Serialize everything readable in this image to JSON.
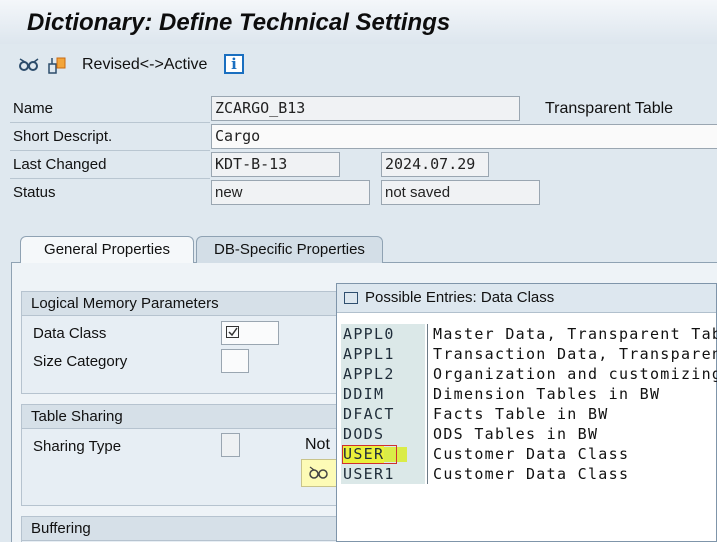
{
  "title": "Dictionary: Define Technical Settings",
  "toolbar": {
    "icons": [
      "glasses-icon",
      "activate-icon",
      "info-icon"
    ],
    "revised_active_label": "Revised<->Active",
    "info_label": "i"
  },
  "header": {
    "name_label": "Name",
    "name_value": "ZCARGO_B13",
    "table_type": "Transparent Table",
    "short_desc_label": "Short Descript.",
    "short_desc_value": "Cargo",
    "last_changed_label": "Last Changed",
    "last_changed_user": "KDT-B-13",
    "last_changed_date": "2024.07.29",
    "status_label": "Status",
    "status_value": "new",
    "status_saved": "not saved"
  },
  "tabs": {
    "general": "General Properties",
    "db_specific": "DB-Specific Properties"
  },
  "logical_memory": {
    "title": "Logical Memory Parameters",
    "data_class_label": "Data Class",
    "size_category_label": "Size Category"
  },
  "table_sharing": {
    "title": "Table Sharing",
    "sharing_type_label": "Sharing Type",
    "not_text": "Not"
  },
  "buffering": {
    "title": "Buffering"
  },
  "popup": {
    "title": "Possible Entries: Data Class",
    "entries": [
      {
        "code": "APPL0",
        "desc": "Master Data, Transparent Tabl"
      },
      {
        "code": "APPL1",
        "desc": "Transaction Data, Transparent"
      },
      {
        "code": "APPL2",
        "desc": "Organization and customizing"
      },
      {
        "code": "DDIM",
        "desc": "Dimension Tables in BW"
      },
      {
        "code": "DFACT",
        "desc": "Facts Table in BW"
      },
      {
        "code": "DODS",
        "desc": "ODS Tables in BW"
      },
      {
        "code": "USER",
        "desc": "Customer Data Class"
      },
      {
        "code": "USER1",
        "desc": "Customer Data Class"
      }
    ]
  },
  "colors": {
    "highlight": "#d9ec2a",
    "selection_border": "#d03030",
    "code_column_bg": "#dbe8e8",
    "info_icon": "#1a6fc0"
  }
}
